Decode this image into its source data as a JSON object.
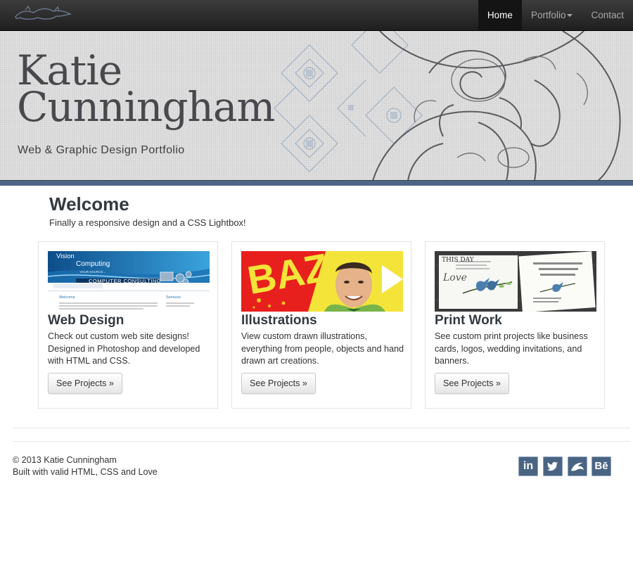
{
  "nav": {
    "items": [
      "Home",
      "Portfolio",
      "Contact"
    ]
  },
  "header": {
    "name_line1": "Katie",
    "name_line2": "Cunningham",
    "tagline": "Web & Graphic Design Portfolio"
  },
  "welcome": {
    "title": "Welcome",
    "subtitle": "Finally a responsive design and a CSS Lightbox!"
  },
  "cards": [
    {
      "title": "Web Design",
      "text": "Check out custom web site designs! Designed in Photoshop and developed with HTML and CSS.",
      "button": "See Projects »",
      "thumb": {
        "brand_line1": "Vision",
        "brand_line2": "Computing",
        "tagline": "YOUR SOURCE...",
        "banner": "COMPUTER CONSULTING",
        "welcome": "Welcome",
        "services": "Services"
      }
    },
    {
      "title": "Illustrations",
      "text": "View custom drawn illustrations, everything from people, objects and hand drawn art creations.",
      "button": "See Projects »",
      "thumb": {
        "word": "BAZ"
      }
    },
    {
      "title": "Print Work",
      "text": "See custom print projects like business cards, logos, wedding invitations, and banners.",
      "button": "See Projects »",
      "thumb": {
        "love": "Love",
        "this_day": "THIS DAY"
      }
    }
  ],
  "footer": {
    "copyright": "© 2013 Katie Cunningham",
    "built": "Built with valid HTML, CSS and Love",
    "social": [
      {
        "name": "linkedin",
        "glyph": "in"
      },
      {
        "name": "twitter",
        "glyph": ""
      },
      {
        "name": "deviantart",
        "glyph": ""
      },
      {
        "name": "behance",
        "glyph": "Bē"
      }
    ]
  },
  "colors": {
    "accent": "#4f6584",
    "social": "#4a6583",
    "navbar": "#2a2a2a"
  }
}
